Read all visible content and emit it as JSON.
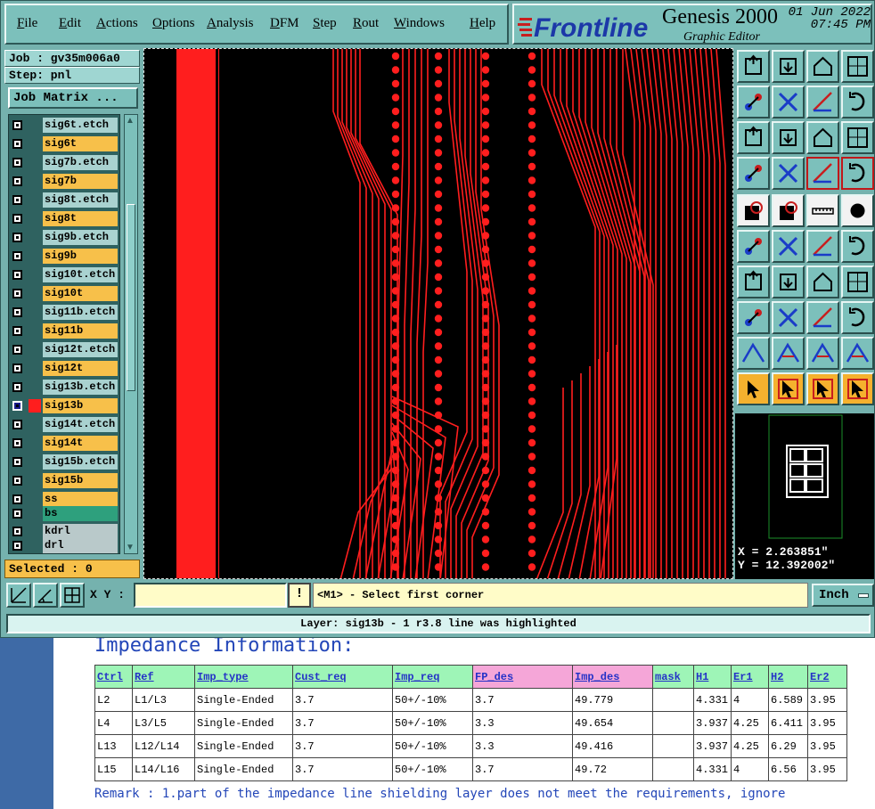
{
  "menu": [
    "File",
    "Edit",
    "Actions",
    "Options",
    "Analysis",
    "DFM",
    "Step",
    "Rout",
    "Windows",
    "Help"
  ],
  "brand": {
    "logo_text": "Frontline",
    "product": "Genesis 2000",
    "subtitle": "Graphic Editor",
    "date": "01 Jun 2022",
    "time": "07:45 PM"
  },
  "job": {
    "job_label": "Job : gv35m006a0",
    "step_label": "Step: pnl",
    "matrix_button": "Job Matrix ..."
  },
  "layers": [
    {
      "name": "sig6t.etch",
      "kind": "etch"
    },
    {
      "name": "sig6t",
      "kind": "sig"
    },
    {
      "name": "sig7b.etch",
      "kind": "etch"
    },
    {
      "name": "sig7b",
      "kind": "sig"
    },
    {
      "name": "sig8t.etch",
      "kind": "etch"
    },
    {
      "name": "sig8t",
      "kind": "sig"
    },
    {
      "name": "sig9b.etch",
      "kind": "etch"
    },
    {
      "name": "sig9b",
      "kind": "sig"
    },
    {
      "name": "sig10t.etch",
      "kind": "etch"
    },
    {
      "name": "sig10t",
      "kind": "sig"
    },
    {
      "name": "sig11b.etch",
      "kind": "etch"
    },
    {
      "name": "sig11b",
      "kind": "sig"
    },
    {
      "name": "sig12t.etch",
      "kind": "etch"
    },
    {
      "name": "sig12t",
      "kind": "sig"
    },
    {
      "name": "sig13b.etch",
      "kind": "etch"
    },
    {
      "name": "sig13b",
      "kind": "active"
    },
    {
      "name": "sig14t.etch",
      "kind": "etch"
    },
    {
      "name": "sig14t",
      "kind": "sig"
    },
    {
      "name": "sig15b.etch",
      "kind": "etch"
    },
    {
      "name": "sig15b",
      "kind": "sig"
    },
    {
      "name": "ss",
      "kind": "sig"
    },
    {
      "name": "bs",
      "kind": "green"
    },
    {
      "name": "kdrl",
      "kind": "grey"
    },
    {
      "name": "drl",
      "kind": "grey"
    }
  ],
  "selected_label": "Selected : 0",
  "coords": {
    "x": "X = 2.263851\"",
    "y": "Y = 12.392002\""
  },
  "bottom": {
    "xy_label": "X Y :",
    "xy_value": "",
    "bang": "!",
    "prompt": "<M1> - Select first corner",
    "units": "Inch"
  },
  "status": "Layer: sig13b - 1 r3.8 line was highlighted",
  "doc": {
    "heading": "Impedance Information:",
    "columns": [
      "Ctrl",
      "Ref",
      "Imp_type",
      "Cust_req",
      "Imp_req",
      "FP_des",
      "Imp_des",
      "mask",
      "H1",
      "Er1",
      "H2",
      "Er2"
    ],
    "rows": [
      [
        "L2",
        "L1/L3",
        "Single-Ended",
        "3.7",
        "50+/-10%",
        "3.7",
        "49.779",
        "",
        "4.331",
        "4",
        "6.589",
        "3.95"
      ],
      [
        "L4",
        "L3/L5",
        "Single-Ended",
        "3.7",
        "50+/-10%",
        "3.3",
        "49.654",
        "",
        "3.937",
        "4.25",
        "6.411",
        "3.95"
      ],
      [
        "L13",
        "L12/L14",
        "Single-Ended",
        "3.7",
        "50+/-10%",
        "3.3",
        "49.416",
        "",
        "3.937",
        "4.25",
        "6.29",
        "3.95"
      ],
      [
        "L15",
        "L14/L16",
        "Single-Ended",
        "3.7",
        "50+/-10%",
        "3.7",
        "49.72",
        "",
        "4.331",
        "4",
        "6.56",
        "3.95"
      ]
    ],
    "remark": "Remark : 1.part of the impedance line shielding layer does not meet the requirements, ignore"
  },
  "colors": {
    "panel": "#75b2ae",
    "copper": "#ff1e1e",
    "canvas": "#000000",
    "highlight_orange": "#f5b12e"
  },
  "tool_icons": [
    "zoom-home-icon",
    "zoom-fit-icon",
    "home-icon",
    "zoom-window-icon",
    "pan-left-icon",
    "pan-right-icon",
    "redraw-icon",
    "snap-icon",
    "zoom-in-icon",
    "zoom-out-icon",
    "scale-1-2-icon",
    "help-icon",
    "measure-icon",
    "grid-icon",
    "layer-compare-icon",
    "net-icon",
    "pad-icon",
    "surface-icon",
    "ruler-icon",
    "circle-icon",
    "connect-icon",
    "cross-icon",
    "move-icon",
    "copy-icon",
    "angle-icon",
    "line-icon",
    "rotate-icon",
    "mirror-icon",
    "pad-add-icon",
    "dash-icon",
    "stretch-icon",
    "symbol-icon",
    "triangle-icon",
    "vertex-icon",
    "arc-icon",
    "span-icon",
    "pointer-icon",
    "select-box-icon",
    "select-circle-icon",
    "select-net-icon"
  ]
}
